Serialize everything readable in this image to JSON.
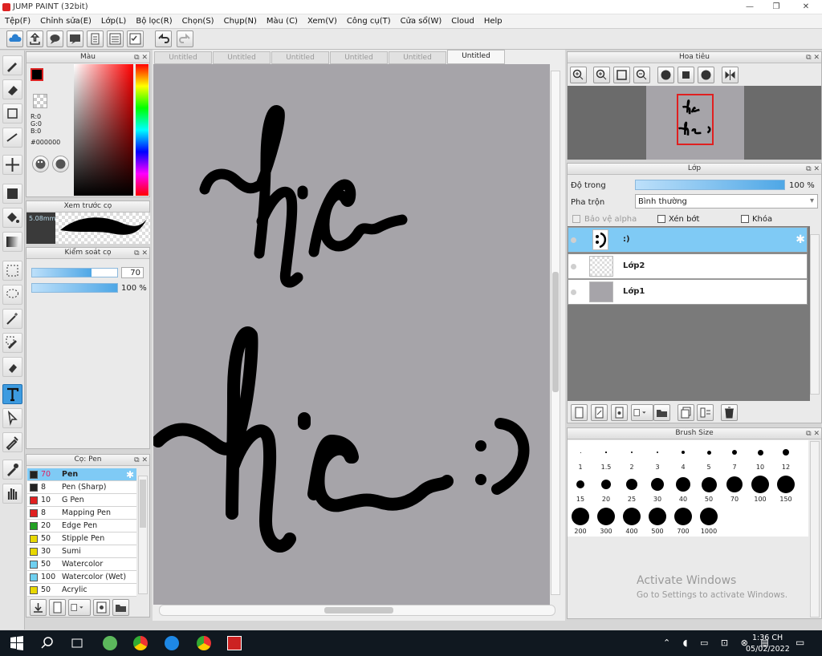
{
  "window": {
    "title": "JUMP PAINT (32bit)",
    "minimize": "—",
    "restore": "❐",
    "close": "✕"
  },
  "menu": [
    "Tệp(F)",
    "Chỉnh sửa(E)",
    "Lớp(L)",
    "Bộ lọc(R)",
    "Chọn(S)",
    "Chụp(N)",
    "Màu (C)",
    "Xem(V)",
    "Công cụ(T)",
    "Cửa sổ(W)",
    "Cloud",
    "Help"
  ],
  "color_panel": {
    "title": "Màu",
    "r": "R:0",
    "g": "G:0",
    "b": "B:0",
    "hex": "#000000"
  },
  "brush_preview": {
    "title": "Xem trước cọ",
    "size": "5.08mm"
  },
  "brush_control": {
    "title": "Kiểm soát cọ",
    "size_value": "70",
    "opacity": "100 %",
    "size_fraction": 0.7,
    "opacity_fraction": 1.0
  },
  "brush_list": {
    "title": "Cọ: Pen",
    "items": [
      {
        "size": "70",
        "name": "Pen",
        "color": "#222222",
        "selected": true
      },
      {
        "size": "8",
        "name": "Pen (Sharp)",
        "color": "#222222"
      },
      {
        "size": "10",
        "name": "G Pen",
        "color": "#e02020"
      },
      {
        "size": "8",
        "name": "Mapping Pen",
        "color": "#e02020"
      },
      {
        "size": "20",
        "name": "Edge Pen",
        "color": "#22a022"
      },
      {
        "size": "50",
        "name": "Stipple Pen",
        "color": "#e8d800"
      },
      {
        "size": "30",
        "name": "Sumi",
        "color": "#e8d800"
      },
      {
        "size": "50",
        "name": "Watercolor",
        "color": "#6fd0f0"
      },
      {
        "size": "100",
        "name": "Watercolor (Wet)",
        "color": "#6fd0f0"
      },
      {
        "size": "50",
        "name": "Acrylic",
        "color": "#e8d800"
      }
    ]
  },
  "doc_tabs": [
    "Untitled",
    "Untitled",
    "Untitled",
    "Untitled",
    "Untitled",
    "Untitled"
  ],
  "navigator": {
    "title": "Hoa tiêu"
  },
  "layer_panel": {
    "title": "Lớp",
    "opacity_label": "Độ trong",
    "opacity_value": "100 %",
    "opacity_fraction": 1.0,
    "blend_label": "Pha trộn",
    "blend_value": "Bình thường",
    "protect_alpha": "Bảo vệ alpha",
    "clipping": "Xén bớt",
    "lock": "Khóa",
    "layers": [
      {
        "name": ":)",
        "selected": true
      },
      {
        "name": "Lớp2"
      },
      {
        "name": "Lớp1"
      }
    ]
  },
  "brush_size": {
    "title": "Brush Size",
    "sizes": [
      "1",
      "1.5",
      "2",
      "3",
      "4",
      "5",
      "7",
      "10",
      "12",
      "15",
      "20",
      "25",
      "30",
      "40",
      "50",
      "70",
      "100",
      "150",
      "200",
      "300",
      "400",
      "500",
      "700",
      "1000"
    ]
  },
  "watermark": {
    "line1": "Activate Windows",
    "line2": "Go to Settings to activate Windows."
  },
  "taskbar": {
    "time": "1:36 CH",
    "date": "05/02/2022"
  }
}
